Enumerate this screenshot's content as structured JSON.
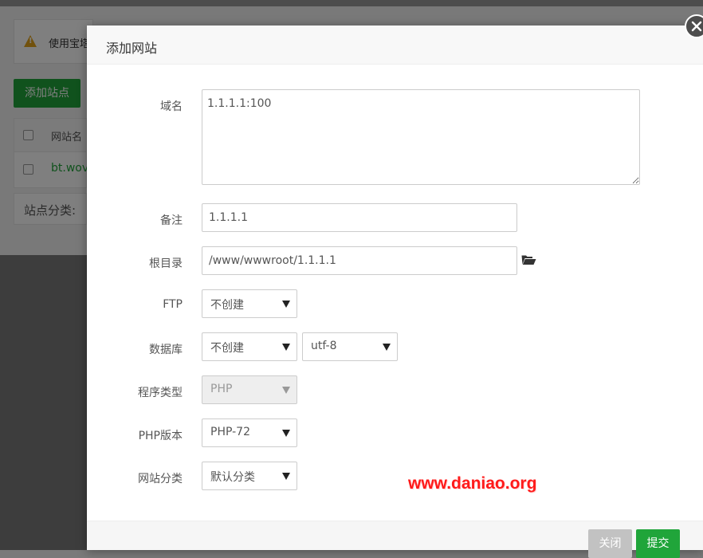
{
  "background": {
    "notice_text": "使用宝塔",
    "add_site_label": "添加站点",
    "table_header_site_name": "网站名",
    "table_row_site": "bt.wov",
    "category_label": "站点分类:"
  },
  "modal": {
    "title": "添加网站",
    "fields": {
      "domain": {
        "label": "域名",
        "value": "1.1.1.1:100"
      },
      "remark": {
        "label": "备注",
        "value": "1.1.1.1"
      },
      "root_dir": {
        "label": "根目录",
        "value": "/www/wwwroot/1.1.1.1"
      },
      "ftp": {
        "label": "FTP",
        "value": "不创建"
      },
      "database": {
        "label": "数据库",
        "value": "不创建",
        "charset": "utf-8"
      },
      "program_type": {
        "label": "程序类型",
        "value": "PHP"
      },
      "php_version": {
        "label": "PHP版本",
        "value": "PHP-72"
      },
      "site_category": {
        "label": "网站分类",
        "value": "默认分类"
      }
    },
    "buttons": {
      "close": "关闭",
      "submit": "提交"
    },
    "watermark": "www.daniao.org"
  },
  "colors": {
    "accent": "#20a53a",
    "watermark": "#ff1a1a",
    "warning": "#e3a21a"
  },
  "icons": {
    "close": "close-icon",
    "folder": "folder-open-icon",
    "warning": "warning-icon"
  }
}
